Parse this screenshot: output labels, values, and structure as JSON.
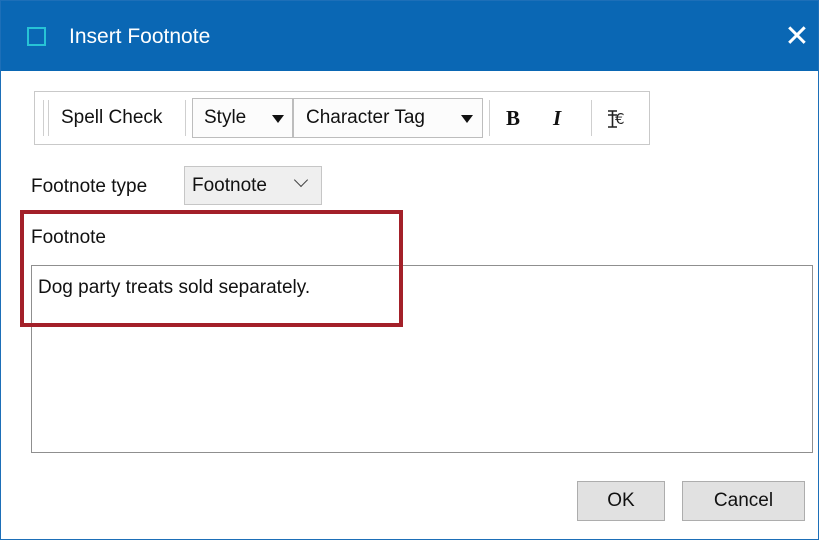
{
  "window": {
    "title": "Insert Footnote",
    "icon": "window-icon",
    "close_glyph": "✕"
  },
  "toolbar": {
    "spell_check": "Spell Check",
    "style": "Style",
    "character_tag": "Character Tag",
    "bold": "B",
    "italic": "I",
    "special_char_glyph": "€"
  },
  "footnote_type": {
    "label": "Footnote type",
    "selected": "Footnote"
  },
  "footnote": {
    "label": "Footnote",
    "text": "Dog party treats sold separately."
  },
  "buttons": {
    "ok": "OK",
    "cancel": "Cancel"
  },
  "colors": {
    "titlebar": "#0a67b4",
    "highlight": "#a32029"
  }
}
